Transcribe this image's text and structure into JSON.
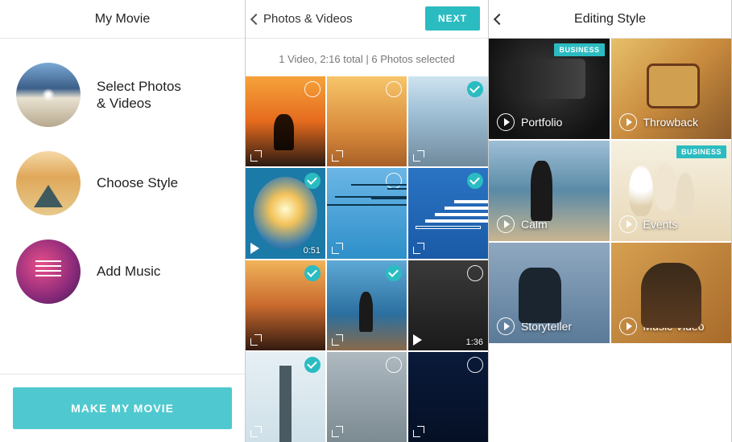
{
  "colors": {
    "accent": "#2bbcc1"
  },
  "screen1": {
    "title": "My Movie",
    "steps": [
      {
        "label": "Select Photos\n& Videos"
      },
      {
        "label": "Choose Style"
      },
      {
        "label": "Add Music"
      }
    ],
    "cta": "MAKE MY MOVIE"
  },
  "screen2": {
    "back_label": "Photos & Videos",
    "next_label": "NEXT",
    "summary": "1 Video, 2:16 total | 6 Photos selected",
    "cells": [
      {
        "selected": false,
        "type": "photo"
      },
      {
        "selected": false,
        "type": "photo"
      },
      {
        "selected": true,
        "type": "photo"
      },
      {
        "selected": true,
        "type": "video",
        "duration": "0:51"
      },
      {
        "selected": false,
        "type": "photo"
      },
      {
        "selected": true,
        "type": "photo"
      },
      {
        "selected": true,
        "type": "photo"
      },
      {
        "selected": true,
        "type": "photo"
      },
      {
        "selected": false,
        "type": "video",
        "duration": "1:36"
      },
      {
        "selected": true,
        "type": "photo"
      },
      {
        "selected": false,
        "type": "photo"
      },
      {
        "selected": false,
        "type": "photo"
      }
    ]
  },
  "screen3": {
    "title": "Editing Style",
    "badge": "BUSINESS",
    "styles": [
      {
        "label": "Portfolio",
        "badge": true
      },
      {
        "label": "Throwback",
        "badge": false
      },
      {
        "label": "Calm",
        "badge": false
      },
      {
        "label": "Events",
        "badge": true
      },
      {
        "label": "Storyteller",
        "badge": false
      },
      {
        "label": "Music Video",
        "badge": false
      }
    ]
  }
}
